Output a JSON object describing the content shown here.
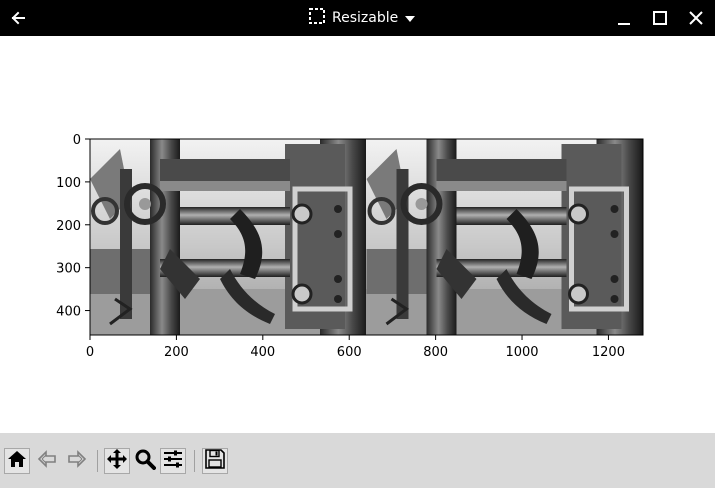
{
  "window": {
    "title": "Resizable",
    "icons": {
      "back": "arrow-left-icon",
      "title": "resize-dashed-square-icon",
      "dropdown": "caret-down-icon",
      "minimize": "minimize-icon",
      "maximize": "maximize-icon",
      "close": "close-icon"
    }
  },
  "figure": {
    "image_description_colors": {
      "foreground": "#000000",
      "background": "#ffffff"
    },
    "x_ticks": [
      "0",
      "200",
      "400",
      "600",
      "800",
      "1000",
      "1200"
    ],
    "y_ticks": [
      "0",
      "100",
      "200",
      "300",
      "400"
    ]
  },
  "chart_data": {
    "type": "image",
    "image_extent": {
      "x": [
        0,
        1280
      ],
      "y": [
        0,
        457
      ]
    },
    "xlim": [
      0,
      1280
    ],
    "ylim": [
      457,
      0
    ],
    "x_ticks": [
      0,
      200,
      400,
      600,
      800,
      1000,
      1200
    ],
    "y_ticks": [
      0,
      100,
      200,
      300,
      400
    ],
    "grid": false,
    "colormap": "gray"
  },
  "toolbar": {
    "buttons": [
      {
        "id": "home",
        "icon": "home-icon"
      },
      {
        "id": "back",
        "icon": "arrow-back-icon"
      },
      {
        "id": "forward",
        "icon": "arrow-forward-icon"
      },
      {
        "id": "pan",
        "icon": "move-arrows-icon"
      },
      {
        "id": "zoom",
        "icon": "magnifier-icon"
      },
      {
        "id": "configure",
        "icon": "sliders-icon"
      },
      {
        "id": "save",
        "icon": "floppy-disk-icon"
      }
    ],
    "colors": {
      "bar": "#d9d9d9",
      "icon": "#000000",
      "disabled_icon": "#808080"
    }
  }
}
